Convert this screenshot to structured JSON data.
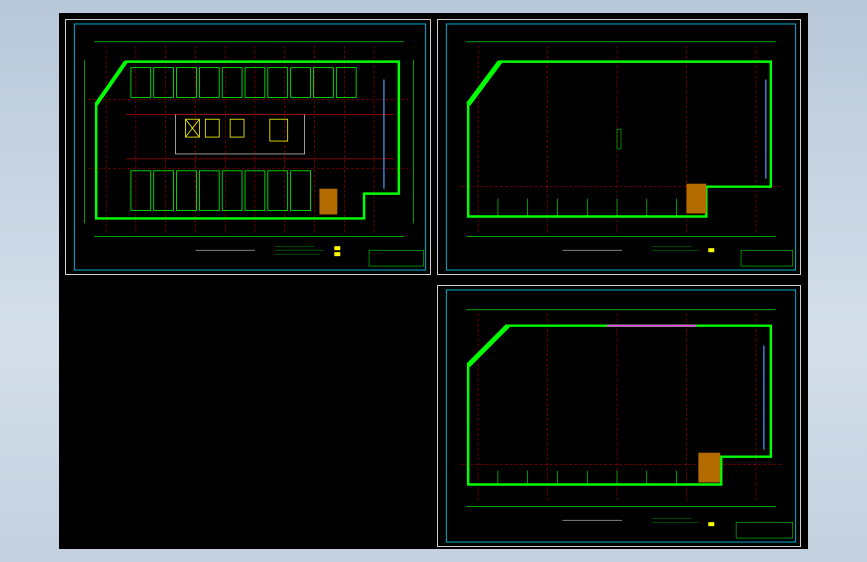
{
  "viewer": {
    "background_color": "#c5d3e2",
    "canvas_color": "#000000"
  },
  "drawings": [
    {
      "id": "sheet-1",
      "kind": "full-floor-plan",
      "frame_color": "#cfcfcf",
      "wall_color": "#00ff00",
      "grid_color": "#ff0000",
      "detail_color": "#ffff00",
      "pipe_color": "#4aa0ff"
    },
    {
      "id": "sheet-2",
      "kind": "open-floor-plan",
      "frame_color": "#cfcfcf",
      "wall_color": "#00ff00",
      "grid_color": "#ff0000",
      "detail_color": "#ffff00",
      "pipe_color": "#4aa0ff"
    },
    {
      "id": "sheet-3",
      "kind": "open-floor-plan",
      "frame_color": "#cfcfcf",
      "wall_color": "#00ff00",
      "grid_color": "#ff0000",
      "detail_color": "#ffff00",
      "pipe_color": "#ff40ff"
    }
  ]
}
